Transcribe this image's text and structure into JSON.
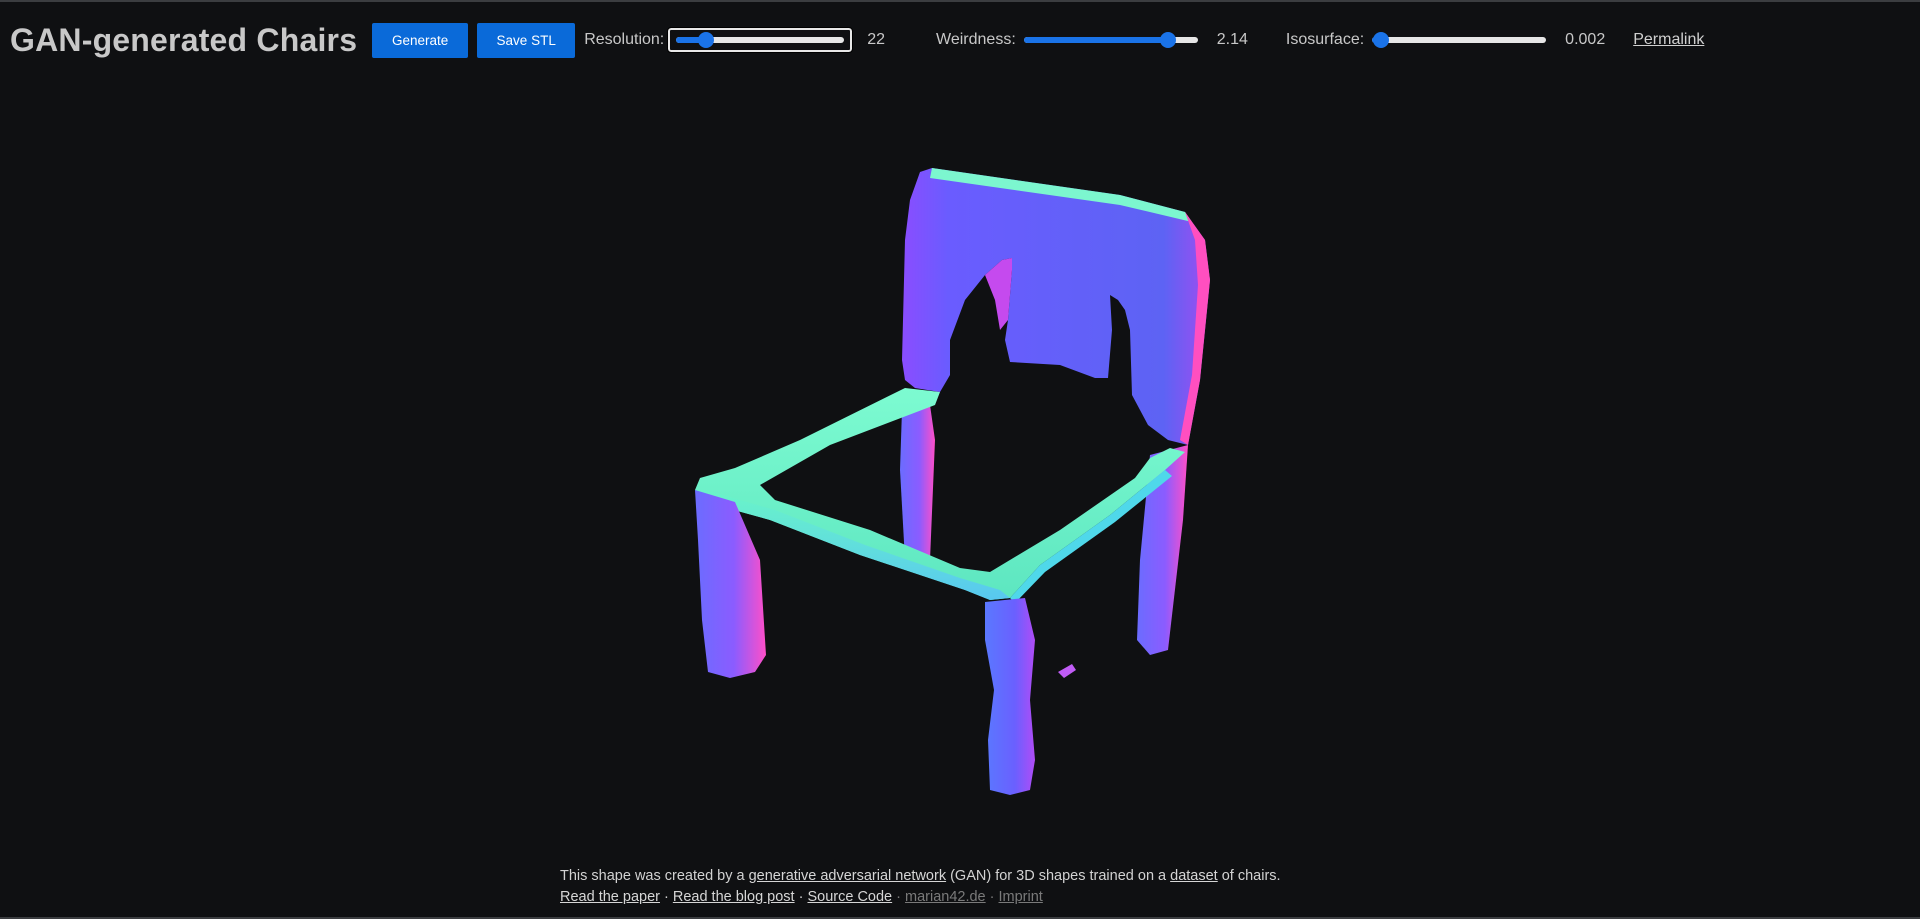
{
  "app": {
    "title": "GAN-generated Chairs"
  },
  "toolbar": {
    "generate_label": "Generate",
    "save_label": "Save STL",
    "resolution": {
      "label": "Resolution:",
      "value": "22",
      "level": 0.18
    },
    "weirdness": {
      "label": "Weirdness:",
      "value": "2.14",
      "level": 0.83
    },
    "isosurface": {
      "label": "Isosurface:",
      "value": "0.002",
      "level": 0.05
    },
    "permalink_label": "Permalink"
  },
  "footer": {
    "line1_pre": "This shape was created by a ",
    "gan_link": "generative adversarial network",
    "line1_mid": " (GAN) for 3D shapes trained on a ",
    "dataset_link": "dataset",
    "line1_post": " of chairs.",
    "links": {
      "paper": "Read the paper",
      "blog": "Read the blog post",
      "source": "Source Code",
      "site": "marian42.de",
      "imprint": "Imprint"
    },
    "separator": " · "
  },
  "colors": {
    "accent": "#0a6ad9",
    "background": "#0f1012"
  }
}
